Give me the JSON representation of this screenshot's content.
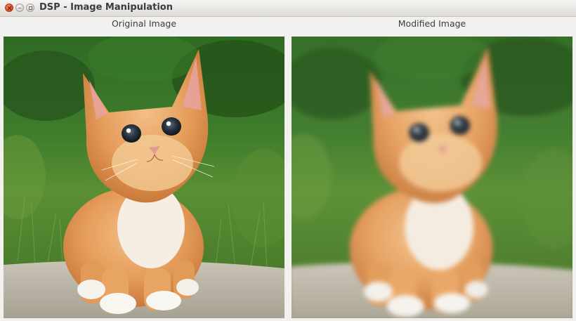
{
  "window": {
    "title": "DSP - Image Manipulation"
  },
  "panels": {
    "original": {
      "label": "Original Image",
      "image": "kitten-on-grass-photo"
    },
    "modified": {
      "label": "Modified Image",
      "image": "kitten-on-grass-photo-blurred"
    }
  },
  "colors": {
    "window_bg": "#f2f1f0",
    "close_button": "#df4b1f",
    "title_text": "#3c3c3c"
  }
}
